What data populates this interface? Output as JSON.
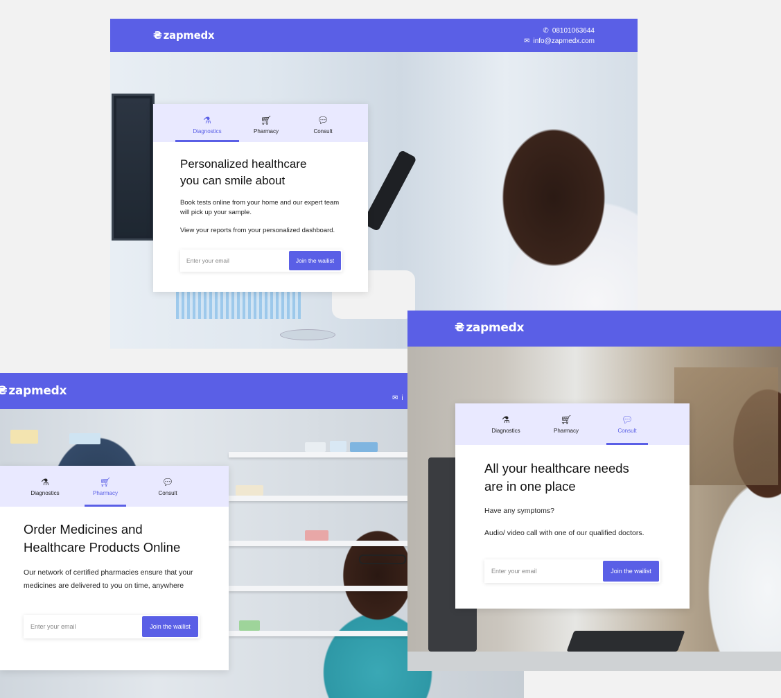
{
  "brand": {
    "logo_mark": "₴",
    "logo_text": "zapmedx"
  },
  "contact": {
    "phone": "08101063644",
    "email": "info@zapmedx.com",
    "email_partial": "i"
  },
  "tabs": {
    "diagnostics": {
      "label": "Diagnostics",
      "icon": "flask-icon"
    },
    "pharmacy": {
      "label": "Pharmacy",
      "icon": "cart-icon"
    },
    "consult": {
      "label": "Consult",
      "icon": "chat-icon"
    }
  },
  "diagnostics_card": {
    "title_line1": "Personalized healthcare",
    "title_line2": "you can smile about",
    "para1": "Book tests online from your home and our expert team will pick up your sample.",
    "para2": "View your reports from your personalized dashboard.",
    "email_placeholder": "Enter your email",
    "cta": "Join the wailist"
  },
  "pharmacy_card": {
    "title_line1": "Order Medicines and",
    "title_line2": "Healthcare Products Online",
    "para1": "Our network of certified pharmacies ensure that your medicines are delivered to you on time, anywhere",
    "email_placeholder": "Enter your email",
    "cta": "Join the wailist"
  },
  "consult_card": {
    "title_line1": "All your healthcare needs",
    "title_line2": "are in one place",
    "para1": "Have any symptoms?",
    "para2": "Audio/ video call with one of our qualified doctors.",
    "email_placeholder": "Enter your email",
    "cta": "Join the wailist"
  },
  "colors": {
    "brand": "#5a5fe6",
    "tab_bg": "#e9e9ff",
    "page_bg": "#f2f2f2"
  }
}
